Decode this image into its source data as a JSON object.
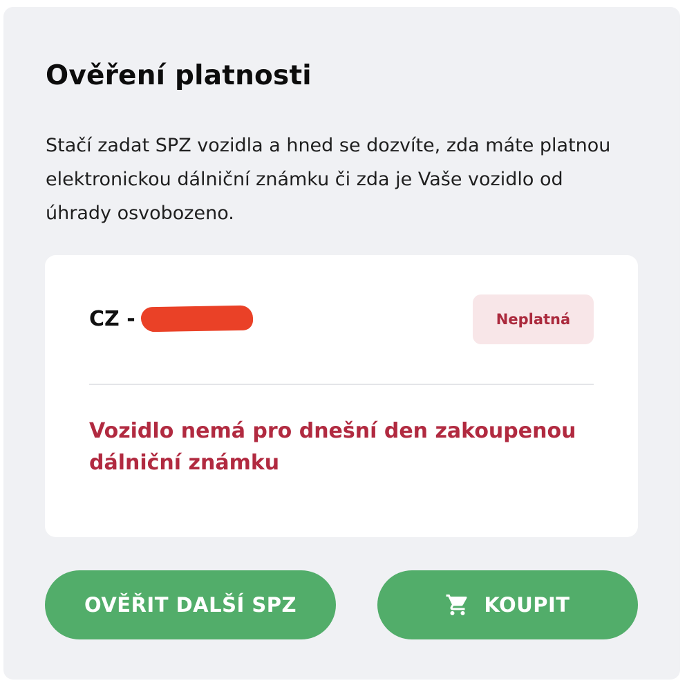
{
  "header": {
    "title": "Ověření platnosti"
  },
  "description": "Stačí zadat SPZ vozidla a hned se dozvíte, zda máte platnou elektronickou dálniční známku či zda je Vaše vozidlo od úhrady osvobozeno.",
  "result": {
    "plate_prefix": "CZ -",
    "status_label": "Neplatná",
    "message": "Vozidlo nemá pro dnešní den zakoupenou dálniční známku"
  },
  "actions": {
    "verify_label": "OVĚŘIT DALŠÍ SPZ",
    "buy_label": "KOUPIT",
    "buy_icon": "cart-icon"
  },
  "colors": {
    "panel_background": "#f0f1f4",
    "card_background": "#ffffff",
    "accent_green": "#52ad6a",
    "error_red": "#b12a40",
    "badge_background": "#f8e6e8",
    "redaction_mark": "#ea4127"
  }
}
